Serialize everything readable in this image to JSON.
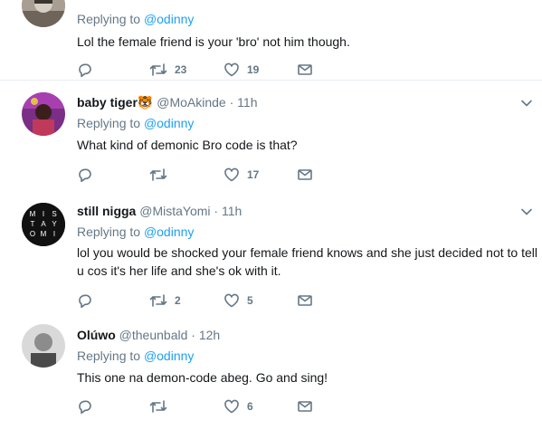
{
  "tweets": [
    {
      "reply_prefix": "Replying to",
      "reply_to": "@odinny",
      "text": "Lol the female friend is your 'bro' not him though.",
      "retweets": "23",
      "likes": "19"
    },
    {
      "name": "baby tiger",
      "emoji": "🐯",
      "handle": "@MoAkinde",
      "dot": "·",
      "time": "11h",
      "reply_prefix": "Replying to",
      "reply_to": "@odinny",
      "text": "What kind of demonic Bro code is that?",
      "likes": "17"
    },
    {
      "name": "still nigga",
      "handle": "@MistaYomi",
      "dot": "·",
      "time": "11h",
      "avatar_letters": [
        "M",
        "I",
        "S",
        "T",
        "A",
        "Y",
        "O",
        "M",
        "I"
      ],
      "reply_prefix": "Replying to",
      "reply_to": "@odinny",
      "text": "lol you would be shocked your female friend knows and she just decided not to tell u cos it's her life and she's ok with it.",
      "retweets": "2",
      "likes": "5"
    },
    {
      "name": "Olúwo",
      "handle": "@theunbald",
      "dot": "·",
      "time": "12h",
      "reply_prefix": "Replying to",
      "reply_to": "@odinny",
      "text": "This one na demon-code abeg. Go and sing!",
      "likes": "6"
    }
  ],
  "colors": {
    "accent": "#1da1f2",
    "muted": "#657786",
    "divider": "#e6ecf0"
  }
}
